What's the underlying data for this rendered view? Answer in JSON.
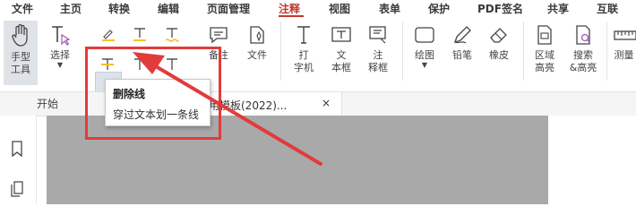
{
  "menu": {
    "items": [
      "文件",
      "主页",
      "转换",
      "编辑",
      "页面管理",
      "注释",
      "视图",
      "表单",
      "保护",
      "PDF签名",
      "共享",
      "互联"
    ],
    "active": "注释"
  },
  "toolbar": {
    "hand_tool": "手型\n工具",
    "select": "选择",
    "note": "备注",
    "file": "文件",
    "typewriter": "打\n字机",
    "textbox": "文\n本框",
    "callout": "注\n释框",
    "draw": "绘图",
    "pencil": "铅笔",
    "eraser": "橡皮",
    "area_highlight": "区域\n高亮",
    "search_highlight": "搜索\n&高亮",
    "measure": "测量"
  },
  "tabs": {
    "start": "开始",
    "document": "通用模板(2022)...",
    "close": "×"
  },
  "tooltip": {
    "title": "删除线",
    "description": "穿过文本划一条线"
  },
  "colors": {
    "accent": "#c0392b",
    "annotation_red": "#e23b3b",
    "highlight_yellow": "#f2c12e",
    "page_gray": "#a9a9a9"
  }
}
